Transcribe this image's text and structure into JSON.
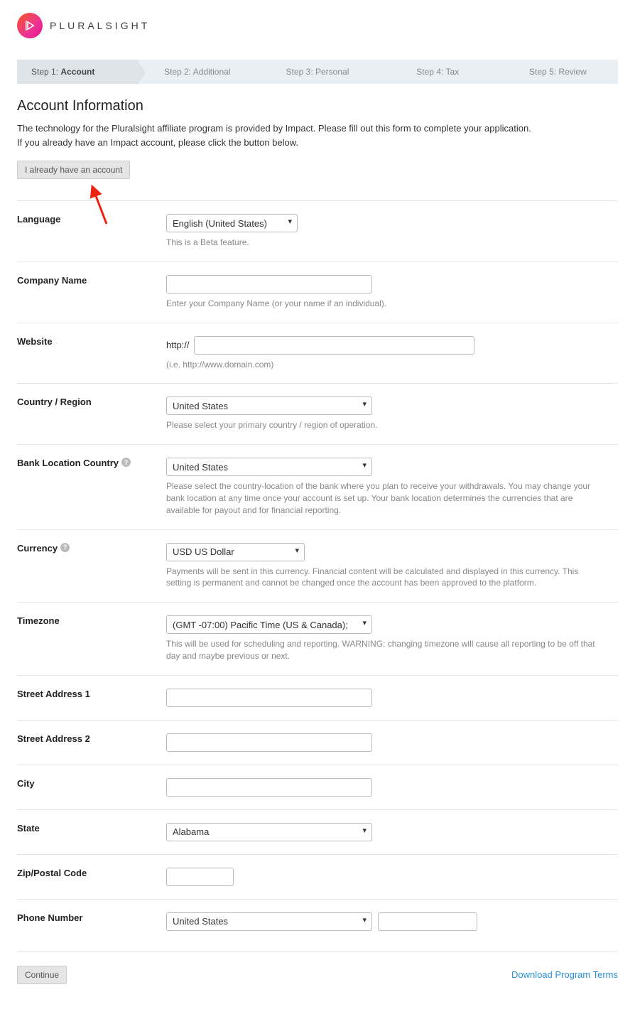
{
  "brand": "PLURALSIGHT",
  "steps": [
    {
      "label": "Step 1:",
      "bold": "Account"
    },
    {
      "label": "Step 2: Additional"
    },
    {
      "label": "Step 3: Personal"
    },
    {
      "label": "Step 4: Tax"
    },
    {
      "label": "Step 5: Review"
    }
  ],
  "title": "Account Information",
  "intro_line1": "The technology for the Pluralsight affiliate program is provided by Impact. Please fill out this form to complete your application.",
  "intro_line2": "If you already have an Impact account, please click the button below.",
  "existing_btn": "I already have an account",
  "form": {
    "language": {
      "label": "Language",
      "value": "English (United States)",
      "hint": "This is a Beta feature."
    },
    "company": {
      "label": "Company Name",
      "value": "",
      "hint": "Enter your Company Name (or your name if an individual)."
    },
    "website": {
      "label": "Website",
      "prefix": "http://",
      "value": "",
      "hint": "(i.e. http://www.domain.com)"
    },
    "country": {
      "label": "Country / Region",
      "value": "United States",
      "hint": "Please select your primary country / region of operation."
    },
    "bank": {
      "label": "Bank Location Country",
      "value": "United States",
      "hint": "Please select the country-location of the bank where you plan to receive your withdrawals. You may change your bank location at any time once your account is set up. Your bank location determines the currencies that are available for payout and for financial reporting."
    },
    "currency": {
      "label": "Currency",
      "value": "USD US Dollar",
      "hint": "Payments will be sent in this currency. Financial content will be calculated and displayed in this currency. This setting is permanent and cannot be changed once the account has been approved to the platform."
    },
    "timezone": {
      "label": "Timezone",
      "value": "(GMT -07:00) Pacific Time (US & Canada);",
      "hint": "This will be used for scheduling and reporting. WARNING: changing timezone will cause all reporting to be off that day and maybe previous or next."
    },
    "street1": {
      "label": "Street Address 1",
      "value": ""
    },
    "street2": {
      "label": "Street Address 2",
      "value": ""
    },
    "city": {
      "label": "City",
      "value": ""
    },
    "state": {
      "label": "State",
      "value": "Alabama"
    },
    "zip": {
      "label": "Zip/Postal Code",
      "value": ""
    },
    "phone": {
      "label": "Phone Number",
      "country": "United States",
      "value": ""
    }
  },
  "continue": "Continue",
  "download": "Download Program Terms"
}
